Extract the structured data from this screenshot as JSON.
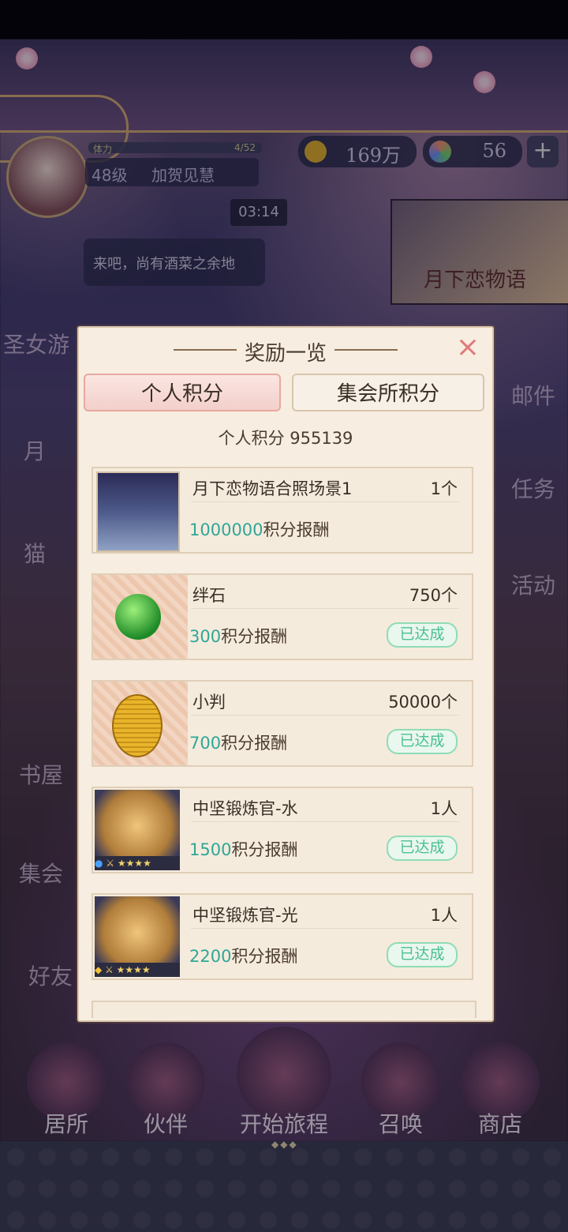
{
  "hud": {
    "level": "48级",
    "player_name": "加贺见慧",
    "energy_label": "体力",
    "energy": "4/52",
    "coins": "169万",
    "gems": "56",
    "plus": "+",
    "timer": "03:14",
    "chat_text": "来吧，尚有酒菜之余地",
    "event_label": "月下恋物语"
  },
  "side_menu": [
    "圣女游",
    "月",
    "猫",
    "邮件",
    "任务",
    "活动",
    "书屋",
    "集会",
    "好友"
  ],
  "bottom_nav": [
    {
      "label": "居所",
      "icon": "house-icon"
    },
    {
      "label": "伙伴",
      "icon": "companion-icon"
    },
    {
      "label": "开始旅程",
      "icon": "journey-icon"
    },
    {
      "label": "召唤",
      "icon": "summon-icon"
    },
    {
      "label": "商店",
      "icon": "shop-icon"
    }
  ],
  "modal": {
    "title": "奖励一览",
    "close": "×",
    "tabs": [
      {
        "label": "个人积分",
        "active": true
      },
      {
        "label": "集会所积分",
        "active": false
      }
    ],
    "score_text": "个人积分 955139",
    "points_suffix": "积分报酬",
    "rewards": [
      {
        "name": "月下恋物语合照场景1",
        "qty": "1个",
        "points": "1000000",
        "status": "",
        "icon": "scene-icon"
      },
      {
        "name": "绊石",
        "qty": "750个",
        "points": "300",
        "status": "已达成",
        "icon": "gem-icon"
      },
      {
        "name": "小判",
        "qty": "50000个",
        "points": "700",
        "status": "已达成",
        "icon": "koban-coin-icon"
      },
      {
        "name": "中坚锻炼官-水",
        "qty": "1人",
        "points": "1500",
        "status": "已达成",
        "icon": "water-character-icon",
        "stars": "★★★★"
      },
      {
        "name": "中坚锻炼官-光",
        "qty": "1人",
        "points": "2200",
        "status": "已达成",
        "icon": "light-character-icon",
        "stars": "★★★★"
      }
    ]
  }
}
